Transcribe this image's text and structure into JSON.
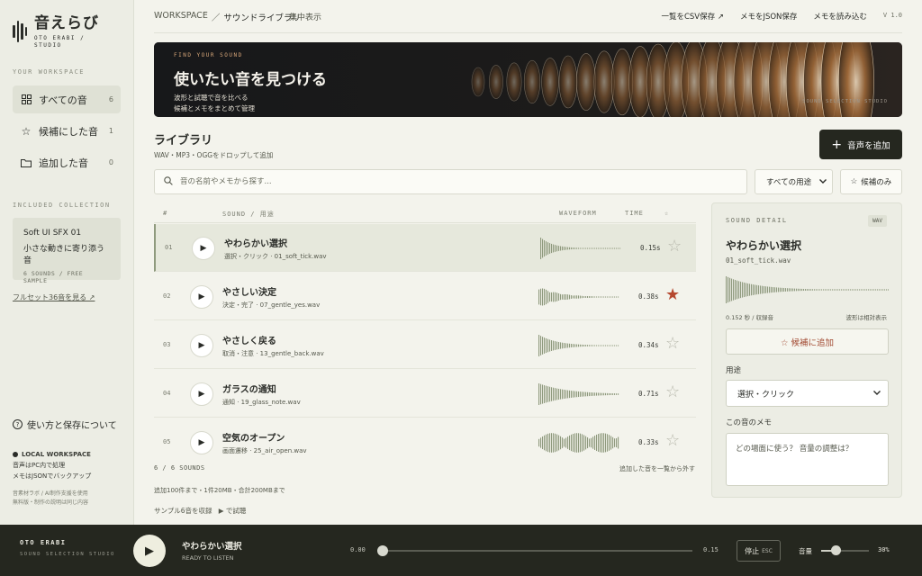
{
  "sidebar": {
    "brand_name": "音えらび",
    "brand_sub": "OTO ERABI / STUDIO",
    "section_workspace": "YOUR WORKSPACE",
    "items": [
      {
        "label": "すべての音",
        "count": "6",
        "icon": "grid-icon"
      },
      {
        "label": "候補にした音",
        "count": "1",
        "icon": "star-icon"
      },
      {
        "label": "追加した音",
        "count": "0",
        "icon": "folder-icon"
      }
    ],
    "section_collection": "INCLUDED COLLECTION",
    "collection": {
      "title": "Soft UI SFX 01",
      "subtitle": "小さな動きに寄り添う音",
      "meta": "6 SOUNDS / FREE SAMPLE"
    },
    "fullset_link": "フルセット36音を見る ↗",
    "help": "使い方と保存について",
    "local": {
      "title": "LOCAL WORKSPACE",
      "line1": "音声はPC内で処理",
      "line2": "メモはJSONでバックアップ"
    },
    "notes": {
      "line1": "音素材ラボ / AI制作支援を使用",
      "line2": "無料版・制作の説明は同じ内容"
    }
  },
  "topbar": {
    "crumb_root": "WORKSPACE",
    "crumb_sep": "／",
    "crumb_current": "サウンドライブラリ",
    "focus": "集中表示",
    "links": [
      "一覧をCSV保存 ↗",
      "メモをJSON保存",
      "メモを読み込む"
    ],
    "version": "V 1.0"
  },
  "hero": {
    "kicker": "FIND YOUR SOUND",
    "title": "使いたい音を見つける",
    "line1": "波形と試聴で音を比べる",
    "line2": "候補とメモをまとめて管理",
    "credit": "SOUND SELECTION STUDIO"
  },
  "library": {
    "title": "ライブラリ",
    "subtitle": "WAV・MP3・OGGをドロップして追加",
    "add_button": "音声を追加",
    "search_placeholder": "音の名前やメモから探す...",
    "filter": "すべての用途",
    "fav_only": "候補のみ",
    "headers": {
      "num": "#",
      "sound": "SOUND / 用途",
      "waveform": "WAVEFORM",
      "time": "TIME"
    },
    "rows": [
      {
        "num": "01",
        "name": "やわらかい選択",
        "meta": "選択・クリック · 01_soft_tick.wav",
        "time": "0.15s",
        "fav": false,
        "selected": true
      },
      {
        "num": "02",
        "name": "やさしい決定",
        "meta": "決定・完了 · 07_gentle_yes.wav",
        "time": "0.38s",
        "fav": true,
        "selected": false
      },
      {
        "num": "03",
        "name": "やさしく戻る",
        "meta": "取消・注意 · 13_gentle_back.wav",
        "time": "0.34s",
        "fav": false,
        "selected": false
      },
      {
        "num": "04",
        "name": "ガラスの通知",
        "meta": "通知 · 19_glass_note.wav",
        "time": "0.71s",
        "fav": false,
        "selected": false
      },
      {
        "num": "05",
        "name": "空気のオープン",
        "meta": "画面遷移 · 25_air_open.wav",
        "time": "0.33s",
        "fav": false,
        "selected": false
      }
    ],
    "count": "6 / 6 SOUNDS",
    "remove_all": "追加した音を一覧から外す",
    "limits": "追加100件まで・1件20MB・合計200MBまで",
    "sample": "サンプル6音を収録",
    "sample_play": "▶ で試聴"
  },
  "detail": {
    "kicker": "SOUND DETAIL",
    "format": "WAV",
    "title": "やわらかい選択",
    "file": "01_soft_tick.wav",
    "length": "0.152 秒 / 収録音",
    "relative": "波形は相対表示",
    "fav_button": "☆ 候補に追加",
    "use_label": "用途",
    "use_value": "選択・クリック",
    "memo_label": "この音のメモ",
    "memo_placeholder": "どの場面に使う？ 音量の調整は？"
  },
  "player": {
    "brand": "OTO ERABI",
    "brand_sub": "SOUND SELECTION STUDIO",
    "title": "やわらかい選択",
    "status": "READY TO LISTEN",
    "t_start": "0.00",
    "t_end": "0.15",
    "progress": 0,
    "stop": "停止",
    "esc": "ESC",
    "volume_label": "音量",
    "volume_value": "30%",
    "volume": 0.3
  },
  "colors": {
    "accent_star": "#b5482f",
    "wave": "#8f9a7e",
    "dark": "#25271f"
  }
}
